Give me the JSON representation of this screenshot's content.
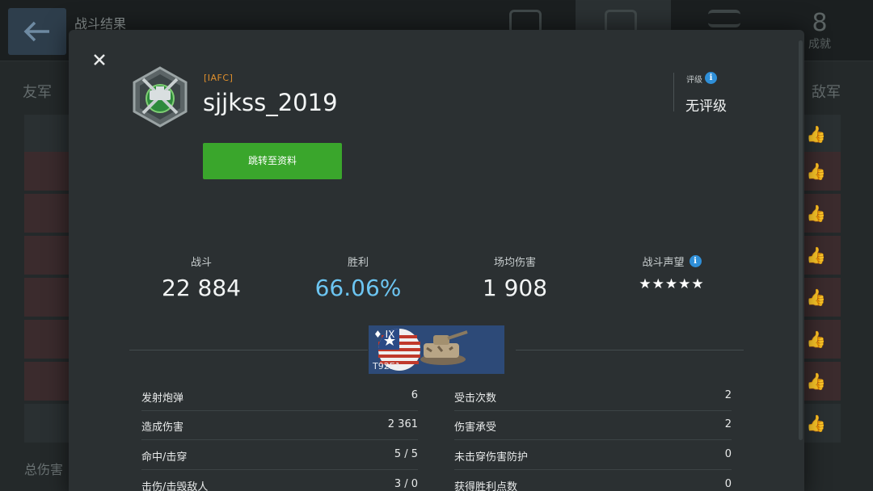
{
  "background": {
    "title": "战斗结果",
    "achievements_label": "成就",
    "allies_label": "友军",
    "enemies_label": "敌军",
    "bottom_label": "总伤害"
  },
  "player": {
    "clan_tag": "[IAFC]",
    "name": "sjjkss_2019",
    "profile_button": "跳转至资料"
  },
  "rating": {
    "label": "评级",
    "value": "无评级"
  },
  "summary": [
    {
      "label": "战斗",
      "value": "22 884"
    },
    {
      "label": "胜利",
      "value": "66.06%"
    },
    {
      "label": "场均伤害",
      "value": "1 908"
    },
    {
      "label": "战斗声望",
      "value": "★★★★★"
    }
  ],
  "tank": {
    "tier": "IX",
    "name": "T92E1",
    "nation": "USA"
  },
  "stats_left": [
    {
      "label": "发射炮弹",
      "value": "6"
    },
    {
      "label": "造成伤害",
      "value": "2 361"
    },
    {
      "label": "命中/击穿",
      "value": "5 / 5"
    },
    {
      "label": "击伤/击毁敌人",
      "value": "3 / 0"
    }
  ],
  "stats_right": [
    {
      "label": "受击次数",
      "value": "2"
    },
    {
      "label": "伤害承受",
      "value": "2"
    },
    {
      "label": "未击穿伤害防护",
      "value": "0"
    },
    {
      "label": "获得胜利点数",
      "value": "0"
    }
  ],
  "colors": {
    "accent_green": "#3aa62c",
    "win_rate_blue": "#6cc5f2",
    "clan_orange": "#e0902c",
    "info_blue": "#2f8fd8"
  }
}
